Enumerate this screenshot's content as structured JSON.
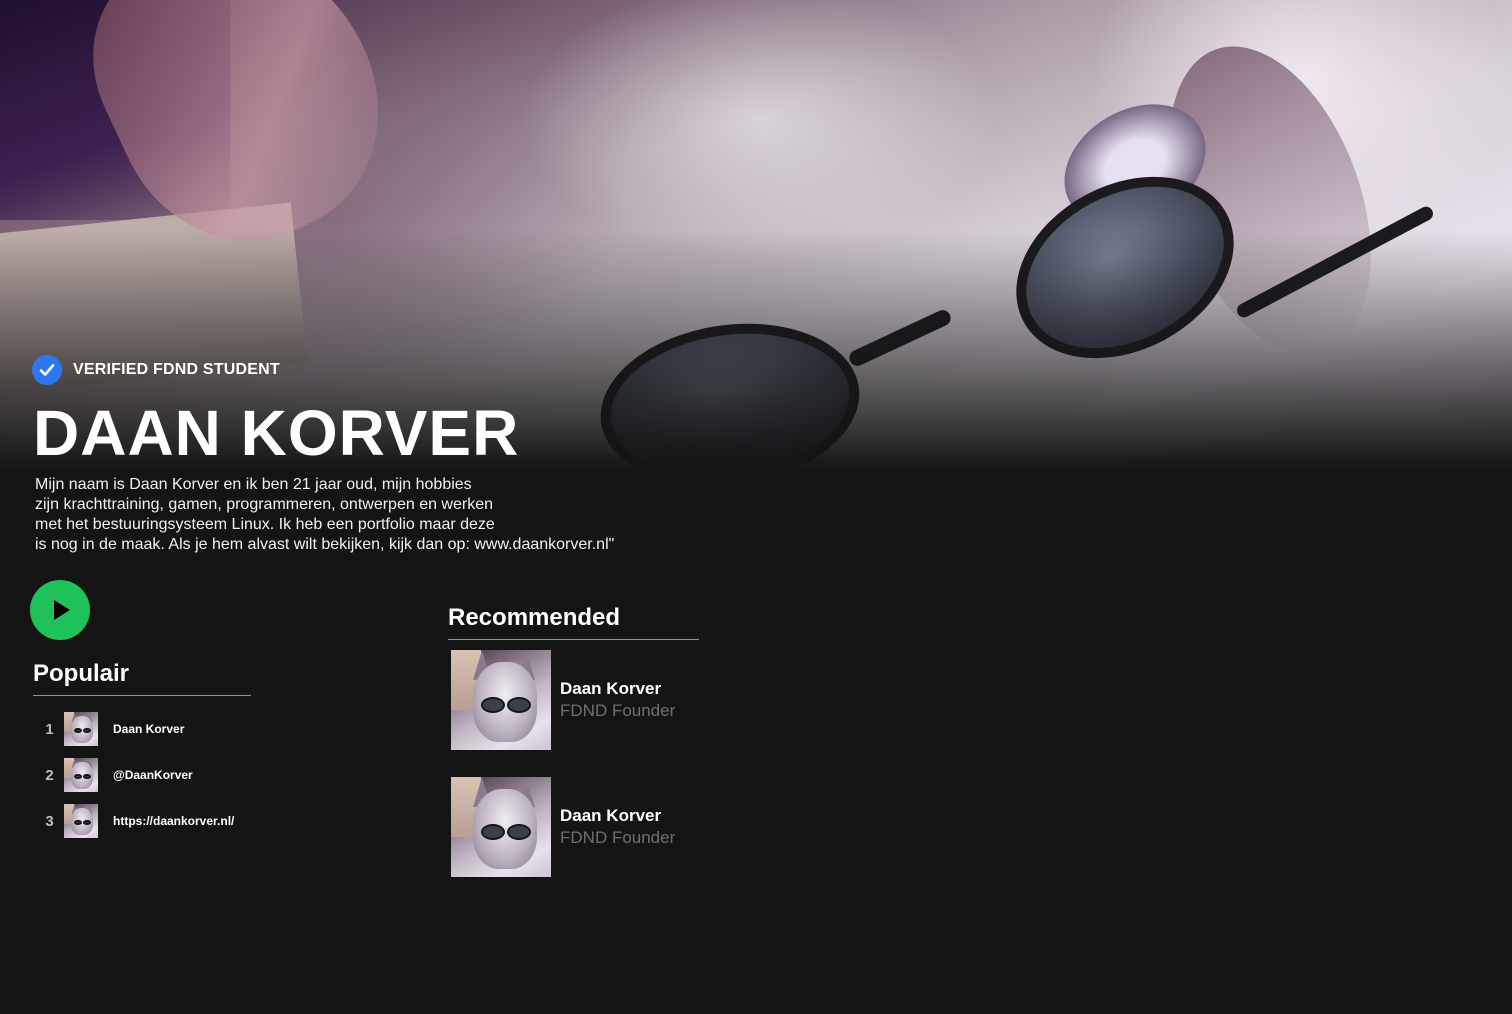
{
  "profile": {
    "verified_label": "VERIFIED FDND STUDENT",
    "name": "DAAN KORVER",
    "bio_lines": [
      "Mijn naam is Daan Korver en ik ben 21 jaar oud, mijn hobbies",
      "zijn krachttraining, gamen, programmeren, ontwerpen en werken",
      "met het bestuuringsysteem Linux. Ik heb een portfolio maar deze",
      "is nog in de maak. Als je hem alvast wilt bekijken, kijk dan op: www.daankorver.nl\""
    ]
  },
  "popular": {
    "title": "Populair",
    "items": [
      {
        "rank": "1",
        "label": "Daan Korver"
      },
      {
        "rank": "2",
        "label": "@DaanKorver"
      },
      {
        "rank": "3",
        "label": "https://daankorver.nl/"
      }
    ]
  },
  "recommended": {
    "title": "Recommended",
    "items": [
      {
        "name": "Daan Korver",
        "role": "FDND Founder"
      },
      {
        "name": "Daan Korver",
        "role": "FDND Founder"
      }
    ]
  },
  "colors": {
    "background": "#141414",
    "accent_green": "#1ec15a",
    "underline_green": "#3fc18e",
    "verified_blue": "#2e77f0",
    "muted_text": "#6f6f6f"
  },
  "icons": {
    "verified": "check-badge-icon",
    "play": "play-icon"
  }
}
